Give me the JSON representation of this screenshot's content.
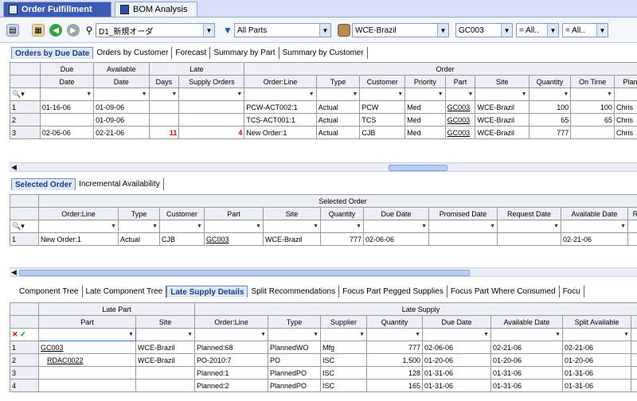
{
  "doc_tabs": [
    {
      "label": "Order Fulfillment"
    },
    {
      "label": "BOM Analysis"
    }
  ],
  "toolbar": {
    "query_value": "D1_新規オーダ",
    "filter_value": "All Parts",
    "site_value": "WCE-Brazil",
    "part_value": "GC003",
    "all1_value": "= All..",
    "all2_value": "= All.."
  },
  "top_tabs": [
    "Orders by Due Date",
    "Orders by Customer",
    "Forecast",
    "Summary by Part",
    "Summary by Customer"
  ],
  "grid1": {
    "group_headers": [
      "Due",
      "Available",
      "Late",
      "Order"
    ],
    "columns": [
      "Date",
      "Date",
      "Days",
      "Supply Orders",
      "Order:Line",
      "Type",
      "Customer",
      "Priority",
      "Part",
      "Site",
      "Quantity",
      "On Time",
      "Plan"
    ],
    "rows": [
      {
        "num": "1",
        "due": "01-16-06",
        "avail": "01-09-06",
        "days": "",
        "supply": "",
        "order": "PCW-ACT002:1",
        "type": "Actual",
        "cust": "PCW",
        "prio": "Med",
        "part": "GC003",
        "site": "WCE-Brazil",
        "qty": "100",
        "ontime": "100",
        "plan": "Chris"
      },
      {
        "num": "2",
        "due": "",
        "avail": "01-09-06",
        "days": "",
        "supply": "",
        "order": "TCS-ACT001:1",
        "type": "Actual",
        "cust": "TCS",
        "prio": "Med",
        "part": "GC003",
        "site": "WCE-Brazil",
        "qty": "65",
        "ontime": "65",
        "plan": "Chris"
      },
      {
        "num": "3",
        "due": "02-06-06",
        "avail": "02-21-06",
        "days": "11",
        "supply": "4",
        "order": "New Order:1",
        "type": "Actual",
        "cust": "CJB",
        "prio": "Med",
        "part": "GC003",
        "site": "WCE-Brazil",
        "qty": "777",
        "ontime": "",
        "plan": "Chris"
      }
    ]
  },
  "mid_tabs": [
    "Selected Order",
    "Incremental Availability"
  ],
  "grid2": {
    "group_header": "Selected Order",
    "columns": [
      "Order:Line",
      "Type",
      "Customer",
      "Part",
      "Site",
      "Quantity",
      "Due Date",
      "Promised Date",
      "Request Date",
      "Available Date",
      "Re"
    ],
    "rows": [
      {
        "num": "1",
        "order": "New Order:1",
        "type": "Actual",
        "cust": "CJB",
        "part": "GC003",
        "site": "WCE-Brazil",
        "qty": "777",
        "due": "02-06-06",
        "prom": "",
        "req": "",
        "avail": "02-21-06"
      }
    ]
  },
  "bottom_tabs": [
    "Component Tree",
    "Late Component Tree",
    "Late Supply Details",
    "Split Recommendations",
    "Focus Part Pegged Supplies",
    "Focus Part Where Consumed",
    "Focu"
  ],
  "grid3": {
    "group_headers": [
      "Late Part",
      "Late Supply"
    ],
    "columns": [
      "Part",
      "Site",
      "Order:Line",
      "Type",
      "Supplier",
      "Quantity",
      "Due Date",
      "Available Date",
      "Split Available"
    ],
    "rows": [
      {
        "num": "1",
        "part": "GC003",
        "site": "WCE-Brazil",
        "order": "Planned:68",
        "type": "PlannedWO",
        "supp": "Mfg",
        "qty": "777",
        "due": "02-06-06",
        "avail": "02-21-06",
        "split": "02-21-06"
      },
      {
        "num": "2",
        "part": "RDAC0022",
        "site": "WCE-Brazil",
        "order": "PO-2010:7",
        "type": "PO",
        "supp": "ISC",
        "qty": "1,500",
        "due": "01-20-06",
        "avail": "01-20-06",
        "split": "01-20-06"
      },
      {
        "num": "3",
        "part": "",
        "site": "",
        "order": "Planned:1",
        "type": "PlannedPO",
        "supp": "ISC",
        "qty": "128",
        "due": "01-31-06",
        "avail": "01-31-06",
        "split": "01-31-06"
      },
      {
        "num": "4",
        "part": "",
        "site": "",
        "order": "Planned:2",
        "type": "PlannedPO",
        "supp": "ISC",
        "qty": "165",
        "due": "01-31-06",
        "avail": "01-31-06",
        "split": "01-31-06"
      }
    ]
  }
}
